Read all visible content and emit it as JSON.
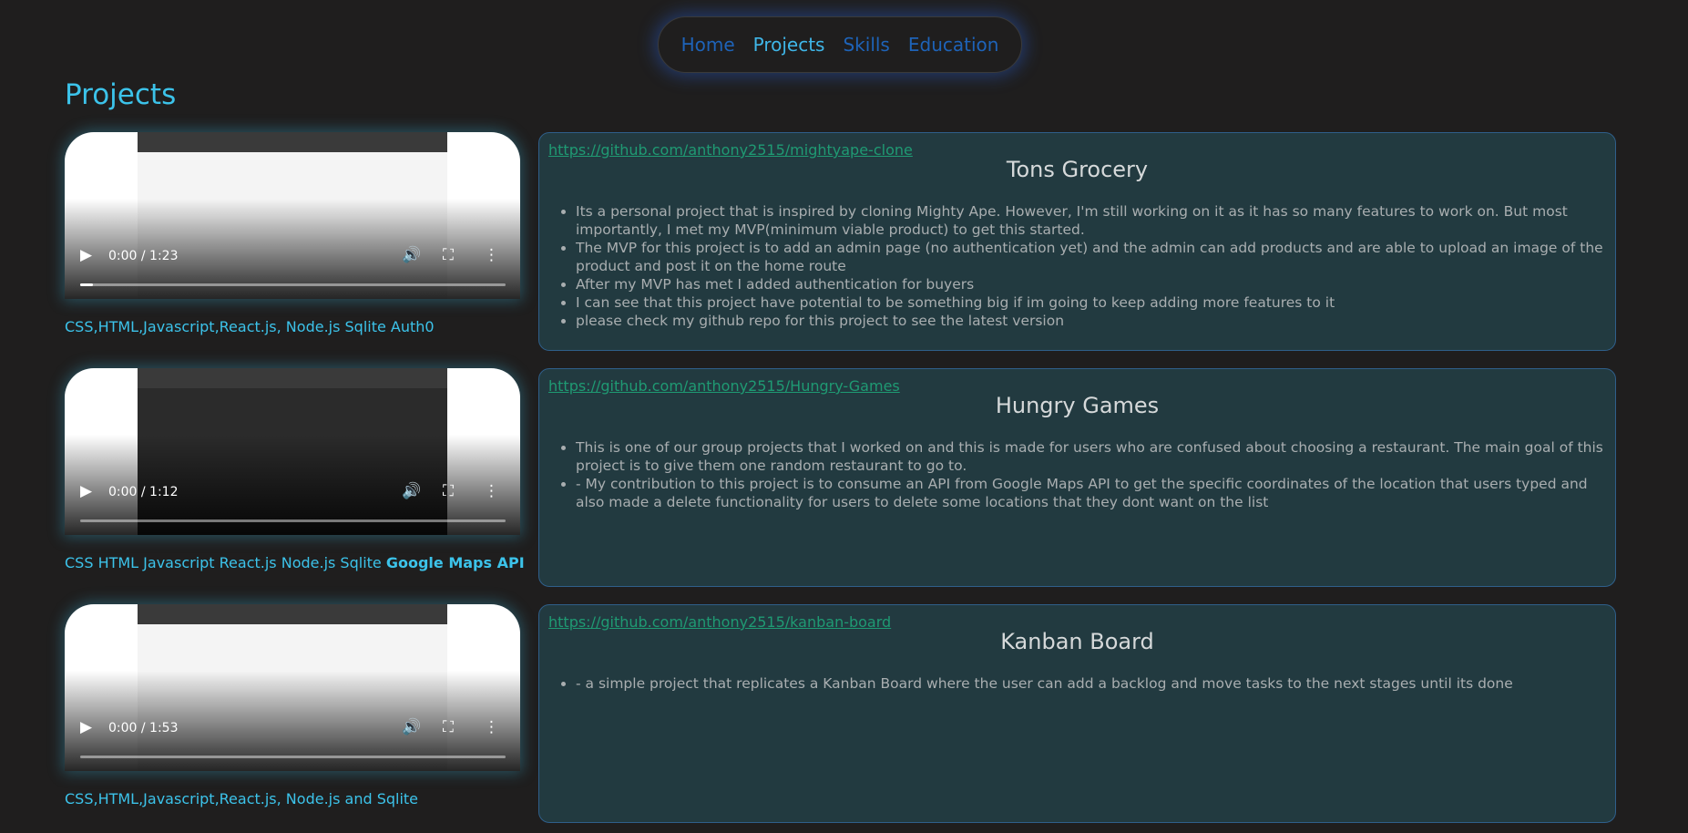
{
  "nav": {
    "items": [
      {
        "label": "Home",
        "active": false
      },
      {
        "label": "Projects",
        "active": true
      },
      {
        "label": "Skills",
        "active": false
      },
      {
        "label": "Education",
        "active": false
      }
    ]
  },
  "page": {
    "title": "Projects"
  },
  "projects": [
    {
      "video_time": "0:00 / 1:23",
      "video_progress": 0.03,
      "tech": "CSS,HTML,Javascript,React.js, Node.js Sqlite Auth0",
      "tech_bold": "",
      "repo": "https://github.com/anthony2515/mightyape-clone",
      "title": "Tons Grocery",
      "bullets": [
        "Its a personal project that is inspired by cloning Mighty Ape. However, I'm still working on it as it has so many features to work on. But most importantly, I met my MVP(minimum viable product) to get this started.",
        "The MVP for this project is to add an admin page (no authentication yet) and the admin can add products and are able to upload an image of the product and post it on the home route",
        "After my MVP has met I added authentication for buyers",
        "I can see that this project have potential to be something big if im going to keep adding more features to it",
        "please check my github repo for this project to see the latest version"
      ]
    },
    {
      "video_time": "0:00 / 1:12",
      "video_progress": 0.0,
      "tech": "CSS HTML Javascript React.js Node.js Sqlite ",
      "tech_bold": "Google Maps API",
      "repo": "https://github.com/anthony2515/Hungry-Games",
      "title": "Hungry Games",
      "bullets": [
        "This is one of our group projects that I worked on and this is made for users who are confused about choosing a restaurant. The main goal of this project is to give them one random restaurant to go to.",
        "- My contribution to this project is to consume an API from Google Maps API to get the specific coordinates of the location that users typed and also made a delete functionality for users to delete some locations that they dont want on the list"
      ]
    },
    {
      "video_time": "0:00 / 1:53",
      "video_progress": 0.0,
      "tech": "CSS,HTML,Javascript,React.js, Node.js and Sqlite",
      "tech_bold": "",
      "repo": "https://github.com/anthony2515/kanban-board",
      "title": "Kanban Board",
      "bullets": [
        "- a simple project that replicates a Kanban Board where the user can add a backlog and move tasks to the next stages until its done"
      ]
    }
  ],
  "icons": {
    "play": "play-icon",
    "volume": "volume-icon",
    "fullscreen": "fullscreen-icon",
    "more": "more-vert-icon"
  },
  "colors": {
    "background": "#1f1e1e",
    "accent": "#3cc3ea",
    "nav_link": "#1e63b8",
    "card_bg": "#223a40",
    "card_border": "#2f5f8a",
    "repo_link": "#1f9a73"
  }
}
